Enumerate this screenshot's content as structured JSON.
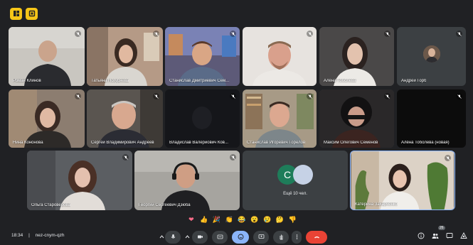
{
  "meeting": {
    "time": "18:34",
    "code": "nez-cnym-qzh"
  },
  "participants": [
    {
      "name": "Роман Клинов",
      "bg": "#c9c6c0"
    },
    {
      "name": "Татьяна Ногуряева",
      "bg": "#b59a86"
    },
    {
      "name": "Станислав Дмитриевич Сем...",
      "bg": "#5d5a78"
    },
    {
      "name": "",
      "bg": "#e7e3df"
    },
    {
      "name": "Алёна Тоболева",
      "bg": "#4a4848"
    },
    {
      "name": "Андрей Горб",
      "bg": "#3c4043"
    },
    {
      "name": "Нина Кононова",
      "bg": "#8c7d70"
    },
    {
      "name": "Сергей Владимирович Андреев",
      "bg": "#5a5550"
    },
    {
      "name": "Владислав Валерйович Ков...",
      "bg": "#15161a"
    },
    {
      "name": "Станислав Игоревич Горелов",
      "bg": "#a79a86"
    },
    {
      "name": "Максим Олегович Семенов",
      "bg": "#2a2829"
    },
    {
      "name": "Алёна Тоболева (новая)",
      "bg": "#0c0c0c"
    },
    {
      "name": "Ольга Староверова",
      "bg": "#5b5e62"
    },
    {
      "name": "Георгий Сергеевич Дзюба",
      "bg": "#a6a49f"
    },
    {
      "name": "Ещё 10 чел.",
      "bg": "#3c4043"
    },
    {
      "name": "Катерина Захарченко",
      "bg": "#dcd2c6"
    }
  ],
  "group_tile": {
    "avatar_letter": "С",
    "label": "Ещё 10 чел."
  },
  "avatar_letter_andrey": "",
  "reactions": [
    "heart",
    "thumbs-up",
    "party",
    "clap",
    "laugh",
    "wow",
    "sad",
    "thinking",
    "thumbs-down"
  ],
  "reaction_glyphs": [
    "❤",
    "👍",
    "🎉",
    "👏",
    "😂",
    "😮",
    "😢",
    "🤔",
    "👎"
  ],
  "colors": {
    "background": "#202124",
    "tile": "#3c4043",
    "accent": "#8ab4f8",
    "hangup": "#ea4335",
    "top_buttons": "#f5c518",
    "highlight_border": "#8ab4f8"
  },
  "icons": {
    "top_left_1": "layout-icon",
    "top_left_2": "pin-icon",
    "controls": [
      "mic-icon",
      "camera-icon",
      "captions-icon",
      "emoji-icon",
      "present-icon",
      "raise-hand-icon",
      "more-icon",
      "hangup-icon"
    ],
    "right": [
      "info-icon",
      "people-icon",
      "chat-icon",
      "activities-icon"
    ]
  },
  "people_count": "26"
}
